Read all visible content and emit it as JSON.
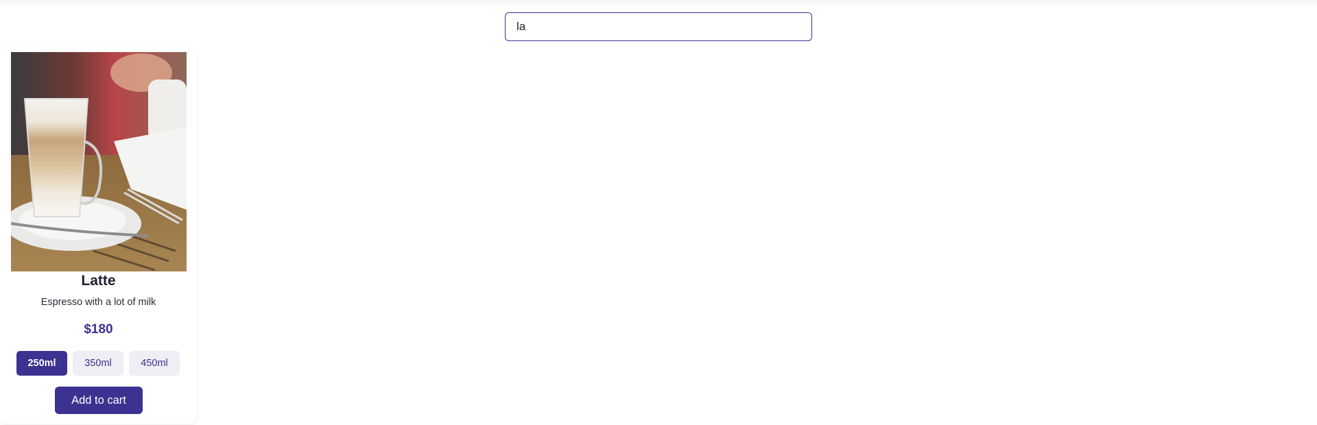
{
  "search": {
    "value": "la"
  },
  "product": {
    "title": "Latte",
    "description": "Espresso with a lot of milk",
    "price": "$180",
    "sizes": [
      {
        "label": "250ml",
        "selected": true
      },
      {
        "label": "350ml",
        "selected": false
      },
      {
        "label": "450ml",
        "selected": false
      }
    ],
    "add_to_cart_label": "Add to cart",
    "image_icon": "latte-glass-photo"
  },
  "colors": {
    "accent": "#3b3291",
    "size_inactive_bg": "#eeeef4"
  }
}
